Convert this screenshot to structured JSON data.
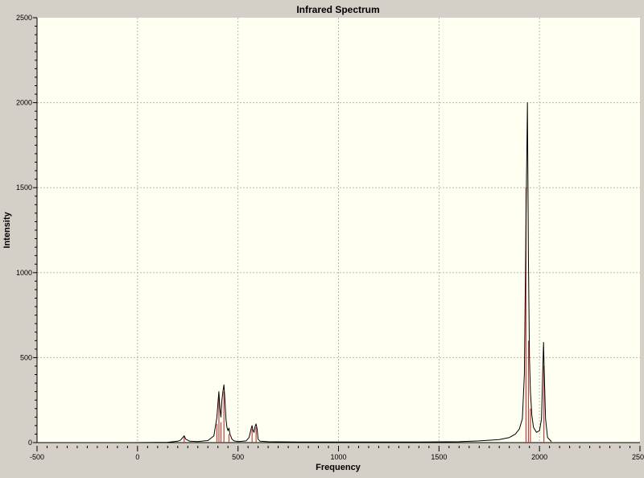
{
  "chart_data": {
    "type": "line",
    "title": "Infrared Spectrum",
    "xlabel": "Frequency",
    "ylabel": "Intensity",
    "xlim": [
      -500,
      2500
    ],
    "ylim": [
      0,
      2500
    ],
    "x_ticks": [
      -500,
      0,
      500,
      1000,
      1500,
      2000,
      2500
    ],
    "y_ticks": [
      0,
      500,
      1000,
      1500,
      2000,
      2500
    ],
    "grid": true,
    "legend": "none",
    "colors": {
      "background": "#d4d0c8",
      "plot_background": "#fffff2",
      "spectrum": "#000000",
      "sticks": "#c04040",
      "grid": "#b8b8b8"
    },
    "series": [
      {
        "kind": "curve",
        "x": [
          -20,
          150,
          200,
          215,
          225,
          232,
          240,
          260,
          300,
          350,
          380,
          395,
          400,
          405,
          410,
          415,
          420,
          425,
          430,
          435,
          440,
          445,
          450,
          455,
          460,
          470,
          480,
          500,
          540,
          555,
          565,
          570,
          575,
          580,
          585,
          590,
          595,
          600,
          610,
          650,
          800,
          1000,
          1200,
          1400,
          1600,
          1700,
          1800,
          1850,
          1880,
          1900,
          1915,
          1925,
          1933,
          1940,
          1945,
          1950,
          1955,
          1962,
          1970,
          1985,
          2000,
          2010,
          2015,
          2020,
          2025,
          2030,
          2040,
          2060
        ],
        "y": [
          0,
          2,
          8,
          15,
          30,
          40,
          20,
          8,
          6,
          12,
          40,
          150,
          230,
          300,
          200,
          150,
          250,
          300,
          340,
          250,
          140,
          90,
          70,
          85,
          50,
          20,
          10,
          6,
          10,
          30,
          80,
          100,
          70,
          60,
          95,
          110,
          80,
          20,
          8,
          5,
          4,
          4,
          4,
          4,
          5,
          10,
          18,
          30,
          50,
          80,
          140,
          400,
          1300,
          2000,
          1100,
          500,
          300,
          160,
          90,
          60,
          70,
          140,
          360,
          590,
          360,
          140,
          30,
          5
        ]
      },
      {
        "kind": "sticks",
        "x": [
          232,
          395,
          405,
          415,
          430,
          455,
          570,
          590,
          1933,
          1945,
          1955,
          2022
        ],
        "y": [
          40,
          110,
          270,
          120,
          300,
          50,
          80,
          90,
          1500,
          600,
          200,
          450
        ]
      }
    ]
  }
}
